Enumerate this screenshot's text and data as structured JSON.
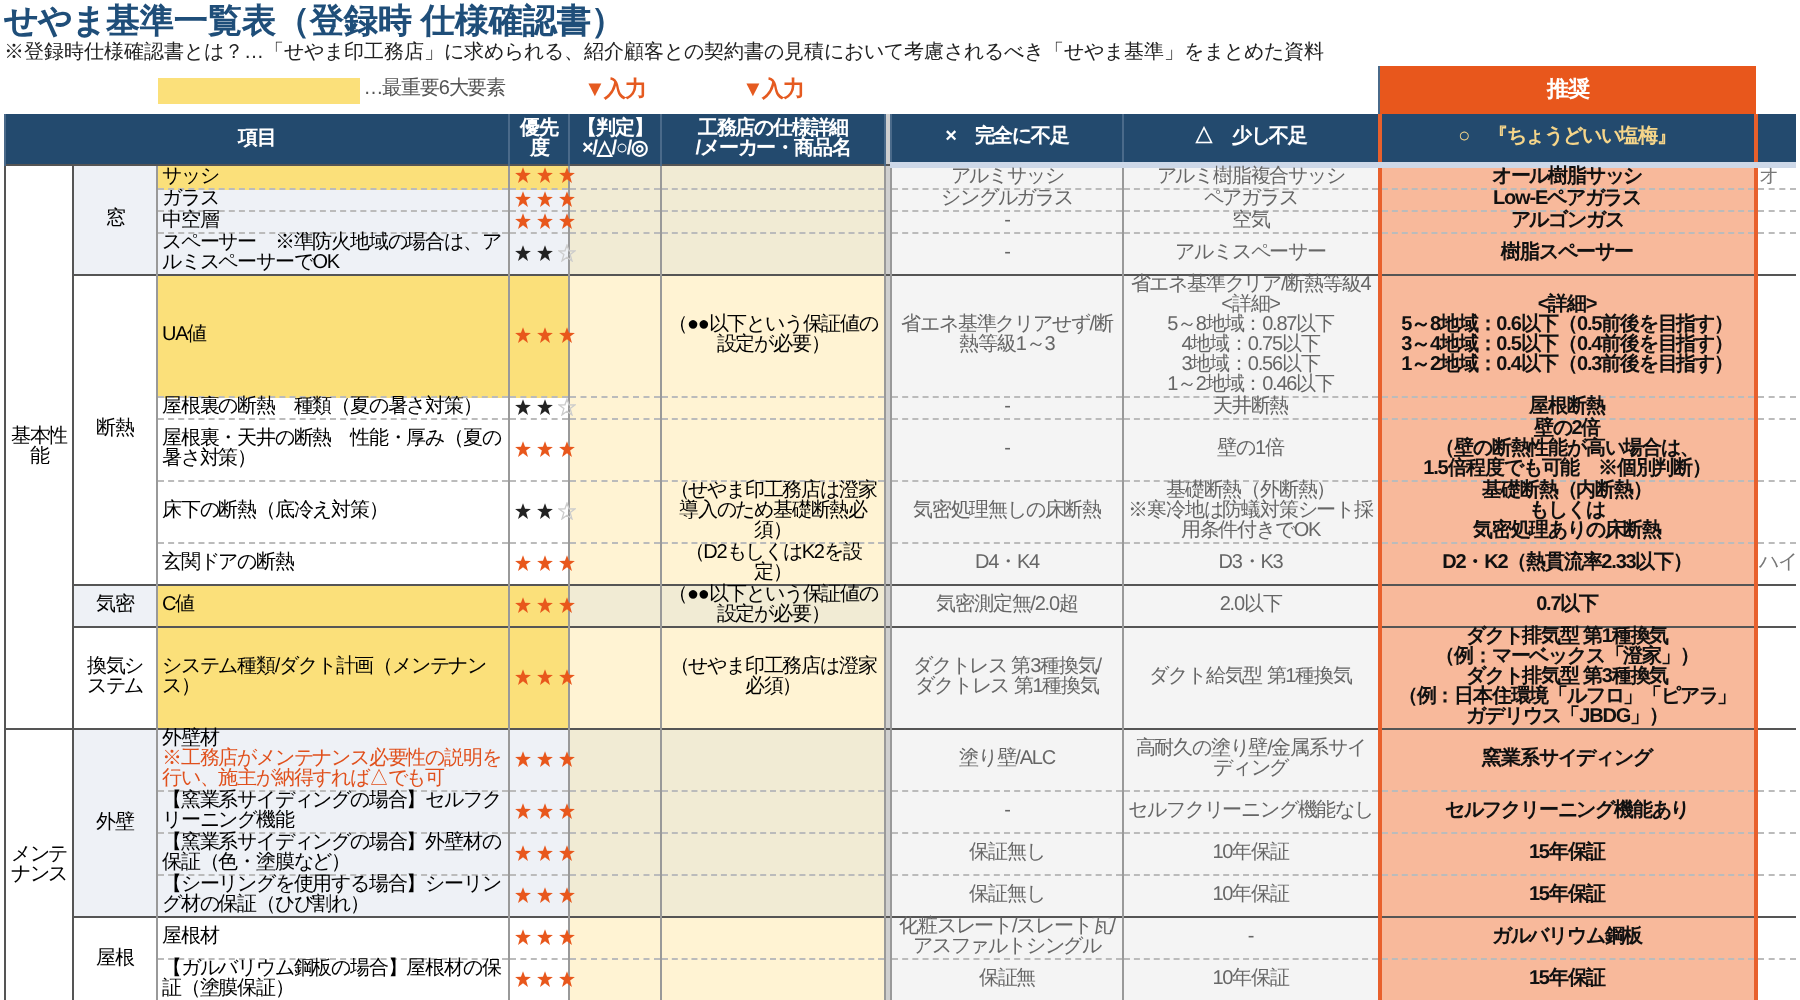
{
  "title": "せやま基準一覧表（登録時 仕様確認書）",
  "subtitle": "※登録時仕様確認書とは？…「せやま印工務店」に求められる、紹介顧客との契約書の見積において考慮されるべき「せやま基準」をまとめた資料",
  "legend": {
    "label": "…最重要6大要素",
    "input_markers": [
      "▼入力",
      "▼入力"
    ],
    "recommended_badge": "推奨"
  },
  "columns": {
    "item": "項目",
    "priority": "優先度",
    "judgement": [
      "【判定】",
      "×/△/○/◎"
    ],
    "spec": [
      "工務店の仕様詳細",
      "/メーカー・商品名"
    ],
    "insufficient": "×　完全に不足",
    "slightly_short": "△　少し不足",
    "just_right": "○　『ちょうどいい塩梅』"
  },
  "categories": [
    {
      "name": "基本性能",
      "groups": [
        {
          "name": "窓",
          "shaded": true,
          "rows": [
            {
              "item": "サッシ",
              "key": true,
              "stars": 3,
              "insufficient": "アルミサッシ",
              "slightly_short": "アルミ樹脂複合サッシ",
              "just_right": "オール樹脂サッシ",
              "column_11": "オ"
            },
            {
              "item": "ガラス",
              "key": false,
              "stars": 3,
              "insufficient": "シングルガラス",
              "slightly_short": "ペアガラス",
              "just_right": "Low-Eペアガラス"
            },
            {
              "item": "中空層",
              "key": false,
              "stars": 3,
              "insufficient": "-",
              "slightly_short": "空気",
              "just_right": "アルゴンガス"
            },
            {
              "item": "スペーサー　※準防火地域の場合は、アルミスペーサーでOK",
              "key": false,
              "stars": 2,
              "insufficient": "-",
              "slightly_short": "アルミスペーサー",
              "just_right": "樹脂スペーサー"
            }
          ]
        },
        {
          "name": "断熱",
          "shaded": false,
          "rows": [
            {
              "item": "UA値",
              "key": true,
              "stars": 3,
              "spec": "（●●以下という保証値の設定が必要）",
              "insufficient": "省エネ基準クリアせず/断熱等級1～3",
              "slightly_short": [
                "省エネ基準クリア/断熱等級4",
                "<詳細>",
                "5～8地域：0.87以下",
                "4地域：0.75以下",
                "3地域：0.56以下",
                "1～2地域：0.46以下"
              ],
              "just_right": [
                "<詳細>",
                "5～8地域：0.6以下（0.5前後を目指す）",
                "3～4地域：0.5以下（0.4前後を目指す）",
                "1～2地域：0.4以下（0.3前後を目指す）"
              ]
            },
            {
              "item": "屋根裏の断熱　種類（夏の暑さ対策）",
              "key": false,
              "stars": 2,
              "insufficient": "-",
              "slightly_short": "天井断熱",
              "just_right": "屋根断熱"
            },
            {
              "item": "屋根裏・天井の断熱　性能・厚み（夏の暑さ対策）",
              "key": false,
              "stars": 3,
              "insufficient": "-",
              "slightly_short": "壁の1倍",
              "just_right": [
                "壁の2倍",
                "（壁の断熱性能が高い場合は、",
                "1.5倍程度でも可能　※個別判断）"
              ]
            },
            {
              "item": "床下の断熱（底冷え対策）",
              "key": false,
              "stars": 2,
              "spec": "（せやま印工務店は澄家導入のため基礎断熱必須）",
              "insufficient": "気密処理無しの床断熱",
              "slightly_short": [
                "基礎断熱（外断熱）",
                "※寒冷地は防蟻対策シート採用条件付きでOK"
              ],
              "just_right": [
                "基礎断熱（内断熱）",
                "もしくは",
                "気密処理ありの床断熱"
              ]
            },
            {
              "item": "玄関ドアの断熱",
              "key": false,
              "stars": 3,
              "spec": "（D2もしくはK2を設定）",
              "insufficient": "D4・K4",
              "slightly_short": "D3・K3",
              "just_right": "D2・K2（熱貫流率2.33以下）",
              "column_11": "ハイ"
            }
          ]
        },
        {
          "name": "気密",
          "shaded": true,
          "rows": [
            {
              "item": "C値",
              "key": true,
              "stars": 3,
              "spec": "（●●以下という保証値の設定が必要）",
              "insufficient": "気密測定無/2.0超",
              "slightly_short": "2.0以下",
              "just_right": "0.7以下"
            }
          ]
        },
        {
          "name": "換気システム",
          "shaded": false,
          "rows": [
            {
              "item": "システム種類/ダクト計画（メンテナンス）",
              "key": true,
              "stars": 3,
              "spec": "（せやま印工務店は澄家必須）",
              "insufficient": [
                "ダクトレス 第3種換気/",
                "ダクトレス 第1種換気"
              ],
              "slightly_short": "ダクト給気型 第1種換気",
              "just_right": [
                "ダクト排気型 第1種換気",
                "（例：マーベックス「澄家」）",
                "ダクト排気型 第3種換気",
                "（例：日本住環境「ルフロ」「ピアラ」",
                "ガデリウス「JBDG」）"
              ]
            }
          ]
        }
      ]
    },
    {
      "name": "メンテナンス",
      "groups": [
        {
          "name": "外壁",
          "shaded": true,
          "rows": [
            {
              "item": "外壁材",
              "note": "※工務店がメンテナンス必要性の説明を行い、施主が納得すれば△でも可",
              "key": false,
              "stars": 3,
              "insufficient": "塗り壁/ALC",
              "slightly_short": "高耐久の塗り壁/金属系サイディング",
              "just_right": "窯業系サイディング"
            },
            {
              "item": "【窯業系サイディングの場合】セルフクリーニング機能",
              "key": false,
              "stars": 3,
              "insufficient": "-",
              "slightly_short": "セルフクリーニング機能なし",
              "just_right": "セルフクリーニング機能あり"
            },
            {
              "item": "【窯業系サイディングの場合】外壁材の保証（色・塗膜など）",
              "key": false,
              "stars": 3,
              "insufficient": "保証無し",
              "slightly_short": "10年保証",
              "just_right": "15年保証"
            },
            {
              "item": "【シーリングを使用する場合】シーリング材の保証（ひび割れ）",
              "key": false,
              "stars": 3,
              "insufficient": "保証無し",
              "slightly_short": "10年保証",
              "just_right": "15年保証"
            }
          ]
        },
        {
          "name": "屋根",
          "shaded": false,
          "rows": [
            {
              "item": "屋根材",
              "key": false,
              "stars": 3,
              "insufficient": [
                "化粧スレート/スレート瓦/",
                "アスファルトシングル"
              ],
              "slightly_short": "-",
              "just_right": "ガルバリウム鋼板"
            },
            {
              "item": "【ガルバリウム鋼板の場合】屋根材の保証（塗膜保証）",
              "key": false,
              "stars": 3,
              "insufficient": "保証無",
              "slightly_short": "10年保証",
              "just_right": "15年保証"
            }
          ]
        }
      ]
    }
  ]
}
